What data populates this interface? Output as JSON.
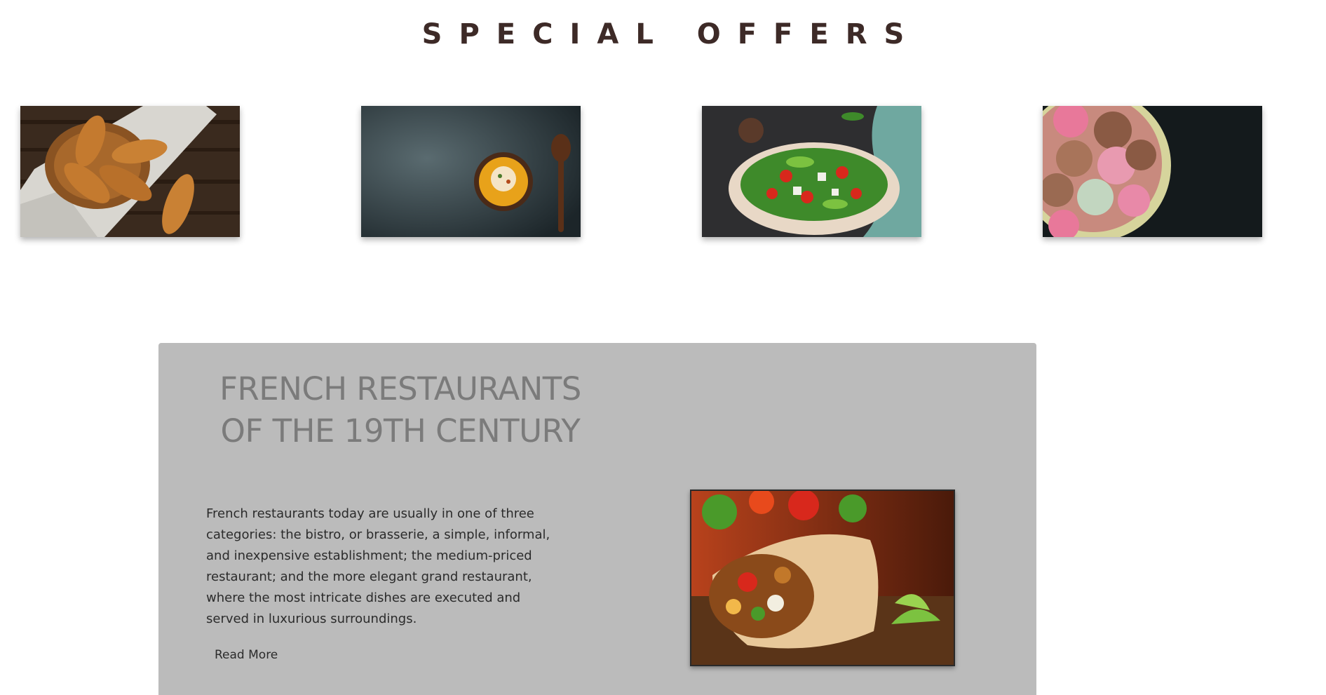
{
  "offers": {
    "title": "SPECIAL OFFERS",
    "cards": [
      {
        "image": "croissants-photo"
      },
      {
        "image": "pumpkin-soup-photo"
      },
      {
        "image": "green-salad-photo"
      },
      {
        "image": "macarons-photo"
      }
    ]
  },
  "feature": {
    "heading": "FRENCH RESTAURANTS OF THE 19TH CENTURY",
    "body": "French restaurants today are usually in one of three categories: the bistro, or brasserie, a simple, informal, and inexpensive establishment; the medium-priced restaurant; and the more elegant grand restaurant, where the most intricate dishes are executed and served in luxurious surroundings.",
    "read_more_label": "Read More",
    "image": "burrito-photo"
  },
  "colors": {
    "title": "#3d2a27",
    "panel_bg": "#bbbbbb",
    "heading": "#7b7b7b",
    "body_text": "#2b2b2b"
  }
}
